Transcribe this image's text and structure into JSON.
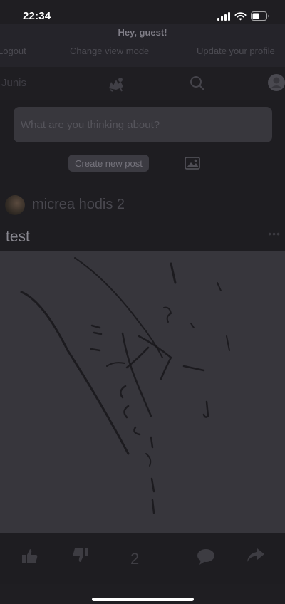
{
  "status_bar": {
    "time": "22:34"
  },
  "header": {
    "greeting": "Hey, guest!",
    "menu": [
      "Logout",
      "Change view mode",
      "Update your profile"
    ]
  },
  "nav": {
    "brand": "Junis"
  },
  "composer": {
    "placeholder": "What are you thinking about?",
    "create_label": "Create new post"
  },
  "post": {
    "author": "micrea hodis 2",
    "title": "test",
    "more": "•••",
    "likes": "2"
  },
  "icons": [
    "signal-icon",
    "wifi-icon",
    "battery-icon",
    "logo-icon",
    "search-icon",
    "profile-icon",
    "image-icon",
    "thumbs-up-icon",
    "thumbs-down-icon",
    "comment-icon",
    "share-icon"
  ],
  "colors": {
    "background": "#1e1d21",
    "image": "#37363c",
    "input": "#38373d"
  }
}
